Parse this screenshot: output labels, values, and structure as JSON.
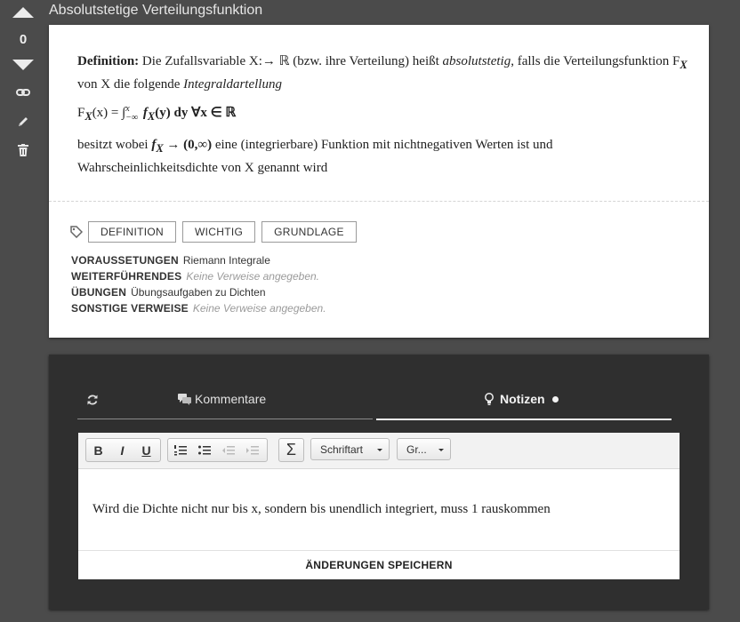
{
  "vote": {
    "score": "0"
  },
  "card": {
    "title": "Absolutstetige Verteilungsfunktion",
    "definition": {
      "lead": "Definition:",
      "t1": " Die Zufallsvariable X:→ ℝ (bzw. ihre Verteilung) heißt ",
      "t1_italic": "absolutstetig",
      "t2": ", falls die Verteilungsfunktion F",
      "t2_sub": "X",
      "t3": " von X die folgende ",
      "t3_italic": "Integraldartellung",
      "formula_lhs": "F",
      "formula_lhs_sub": "X",
      "formula_arg": "(x) = ∫",
      "formula_lim_upper": "x",
      "formula_lim_lower": "−∞",
      "formula_rhs": " f",
      "formula_rhs_sub": "X",
      "formula_rest": "(y) dy ∀x ∈ ℝ",
      "t4": "besitzt wobei ",
      "t4_fx": "f",
      "t4_fx_sub": "X",
      "t4_range": " → (0,∞)",
      "t5": " eine (integrierbare) Funktion mit nichtnegativen Werten ist und Wahrscheinlichkeitsdichte von X genannt wird"
    },
    "tags": [
      "DEFINITION",
      "WICHTIG",
      "GRUNDLAGE"
    ],
    "meta": [
      {
        "label": "VORAUSSETUNGEN",
        "value": "Riemann Integrale",
        "empty": false
      },
      {
        "label": "WEITERFÜHRENDES",
        "value": "Keine Verweise angegeben.",
        "empty": true
      },
      {
        "label": "ÜBUNGEN",
        "value": "Übungsaufgaben zu Dichten",
        "empty": false
      },
      {
        "label": "SONSTIGE VERWEISE",
        "value": "Keine Verweise angegeben.",
        "empty": true
      }
    ]
  },
  "panel": {
    "tab_comments": "Kommentare",
    "tab_notes": "Notizen",
    "toolbar": {
      "bold": "B",
      "italic": "I",
      "underline": "U",
      "font": "Schriftart",
      "size": "Gr..."
    },
    "editor_text": "Wird die Dichte nicht nur bis x, sondern bis unendlich integriert, muss 1 rauskommen",
    "save_label": "ÄNDERUNGEN SPEICHERN"
  }
}
